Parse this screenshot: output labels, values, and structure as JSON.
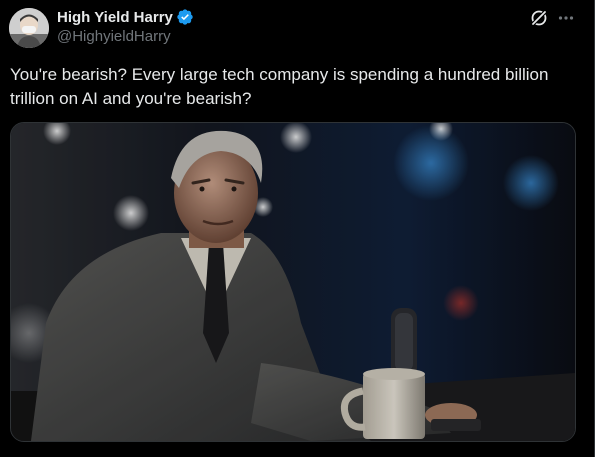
{
  "tweet": {
    "author": {
      "display_name": "High Yield Harry",
      "handle": "@HighyieldHarry",
      "verified": true,
      "verified_color": "#1d9bf0",
      "avatar_icon": "avatar-masked-person"
    },
    "text": "You're bearish? Every large tech company is spending a hundred billion trillion on AI and you're bearish?",
    "actions": {
      "grok_icon": "grok-icon",
      "more_icon": "more-horizontal-icon"
    },
    "media": {
      "type": "image",
      "icon": "photo-man-at-bar"
    }
  },
  "colors": {
    "background": "#000000",
    "text_primary": "#e7e9ea",
    "text_secondary": "#71767b",
    "border": "#2f3336"
  }
}
